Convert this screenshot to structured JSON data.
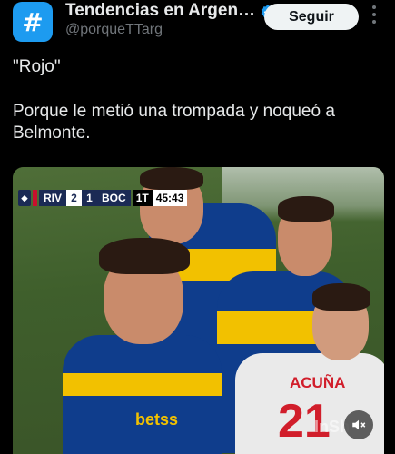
{
  "header": {
    "avatar_icon": "hashtag-icon",
    "avatar_symbol": "#",
    "display_name": "Tendencias en Argen…",
    "verified_icon": "verified-badge-icon",
    "handle": "@porqueTTarg",
    "follow_label": "Seguir",
    "more_icon": "more-options-icon"
  },
  "tweet": {
    "line1": "\"Rojo\"",
    "line2": "Porque le metió una trompada y noqueó a Belmonte."
  },
  "media": {
    "scorebug": {
      "team_home": "RIV",
      "score_home": "2",
      "score_away": "1",
      "team_away": "BOC",
      "half": "1T",
      "clock": "45:43"
    },
    "jersey_sponsor": "betss",
    "jersey_name": "ACUÑA",
    "jersey_number": "21",
    "watermark": "InSh",
    "mute_icon": "volume-mute-icon"
  },
  "colors": {
    "accent": "#1d9bf0",
    "background": "#000000",
    "follow_button": "#eff3f4",
    "boca_blue": "#0f3d8c",
    "boca_gold": "#f2c100"
  }
}
